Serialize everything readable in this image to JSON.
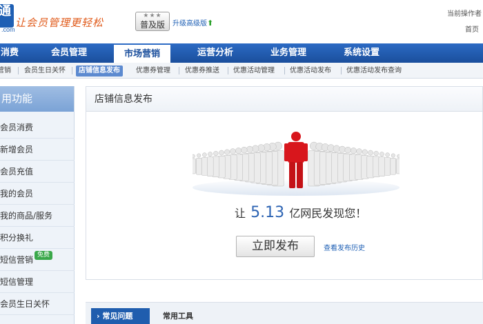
{
  "header": {
    "logo_text": "通",
    "logo_domain": ".com",
    "slogan": "让会员管理更轻松",
    "edition_stars": "★★★",
    "edition": "普及版",
    "upgrade_link": "升级高级版",
    "operator_label": "当前操作者",
    "home_link": "首页"
  },
  "main_nav": [
    {
      "label": "消费",
      "active": false
    },
    {
      "label": "会员管理",
      "active": false
    },
    {
      "label": "市场营销",
      "active": true
    },
    {
      "label": "运营分析",
      "active": false
    },
    {
      "label": "业务管理",
      "active": false
    },
    {
      "label": "系统设置",
      "active": false
    }
  ],
  "sub_nav": [
    {
      "label": "营销",
      "active": false
    },
    {
      "label": "会员生日关怀",
      "active": false
    },
    {
      "label": "店铺信息发布",
      "active": true
    },
    {
      "label": "优惠券管理",
      "active": false
    },
    {
      "label": "优惠券推送",
      "active": false
    },
    {
      "label": "优惠活动管理",
      "active": false
    },
    {
      "label": "优惠活动发布",
      "active": false
    },
    {
      "label": "优惠活动发布查询",
      "active": false
    }
  ],
  "sidebar": {
    "title": "用功能",
    "items": [
      {
        "label": "会员消费"
      },
      {
        "label": "新增会员"
      },
      {
        "label": "会员充值"
      },
      {
        "label": "我的会员"
      },
      {
        "label": "我的商品/服务"
      },
      {
        "label": "积分换礼"
      },
      {
        "label": "短信营销",
        "badge": "免费"
      },
      {
        "label": "短信管理"
      },
      {
        "label": "会员生日关怀"
      }
    ]
  },
  "panel": {
    "title": "店铺信息发布",
    "headline_prefix": "让",
    "headline_number": "5.13",
    "headline_suffix": "亿网民发现您！",
    "publish_button": "立即发布",
    "history_link": "查看发布历史"
  },
  "bottom": {
    "faq_tab": "› 常见问题",
    "tools_tab": "常用工具"
  },
  "colors": {
    "nav_blue": "#1a4e9c",
    "highlight_red": "#d8161c",
    "figure_gray": "#e8e8e8",
    "number_blue": "#2c63b3"
  }
}
